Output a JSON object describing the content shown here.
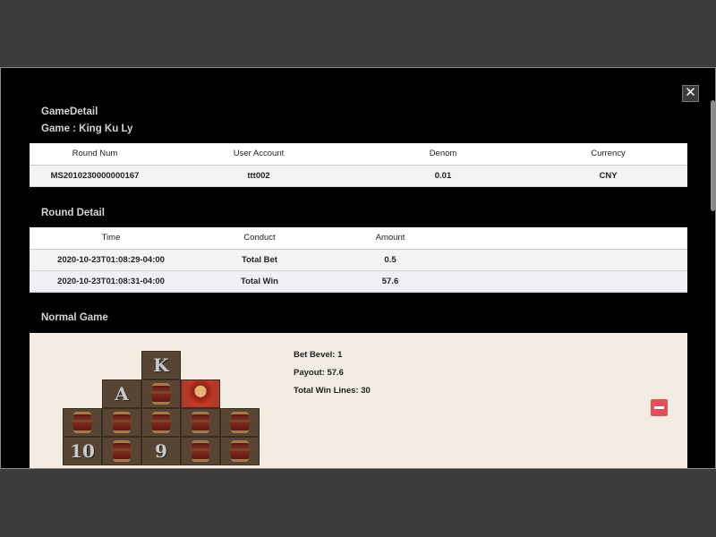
{
  "modal": {
    "close_glyph": "✕",
    "title": "GameDetail",
    "game_line": "Game : King Ku Ly"
  },
  "game_table": {
    "headers": [
      "Round Num",
      "User Account",
      "Denom",
      "Currency"
    ],
    "row": [
      "MS2010230000000167",
      "ttt002",
      "0.01",
      "CNY"
    ]
  },
  "round_detail": {
    "heading": "Round Detail",
    "headers": [
      "Time",
      "Conduct",
      "Amount",
      ""
    ],
    "rows": [
      [
        "2020-10-23T01:08:29-04:00",
        "Total Bet",
        "0.5",
        ""
      ],
      [
        "2020-10-23T01:08:31-04:00",
        "Total Win",
        "57.6",
        ""
      ]
    ]
  },
  "normal_game": {
    "heading": "Normal Game",
    "bet_level": "Bet Bevel: 1",
    "payout": "Payout: 57.6",
    "total_win_lines": "Total Win Lines: 30",
    "grid": [
      [
        "",
        "",
        "",
        "",
        ""
      ],
      [
        "",
        "",
        "K",
        "",
        ""
      ],
      [
        "",
        "A",
        "barrel",
        "character",
        ""
      ],
      [
        "barrel",
        "barrel",
        "barrel",
        "barrel",
        "barrel"
      ],
      [
        "10",
        "barrel",
        "9",
        "barrel",
        "barrel"
      ]
    ],
    "collapse_icon": "minus-icon",
    "colors": {
      "panel": "#f1ebe2",
      "collapse": "#e0505a"
    }
  }
}
